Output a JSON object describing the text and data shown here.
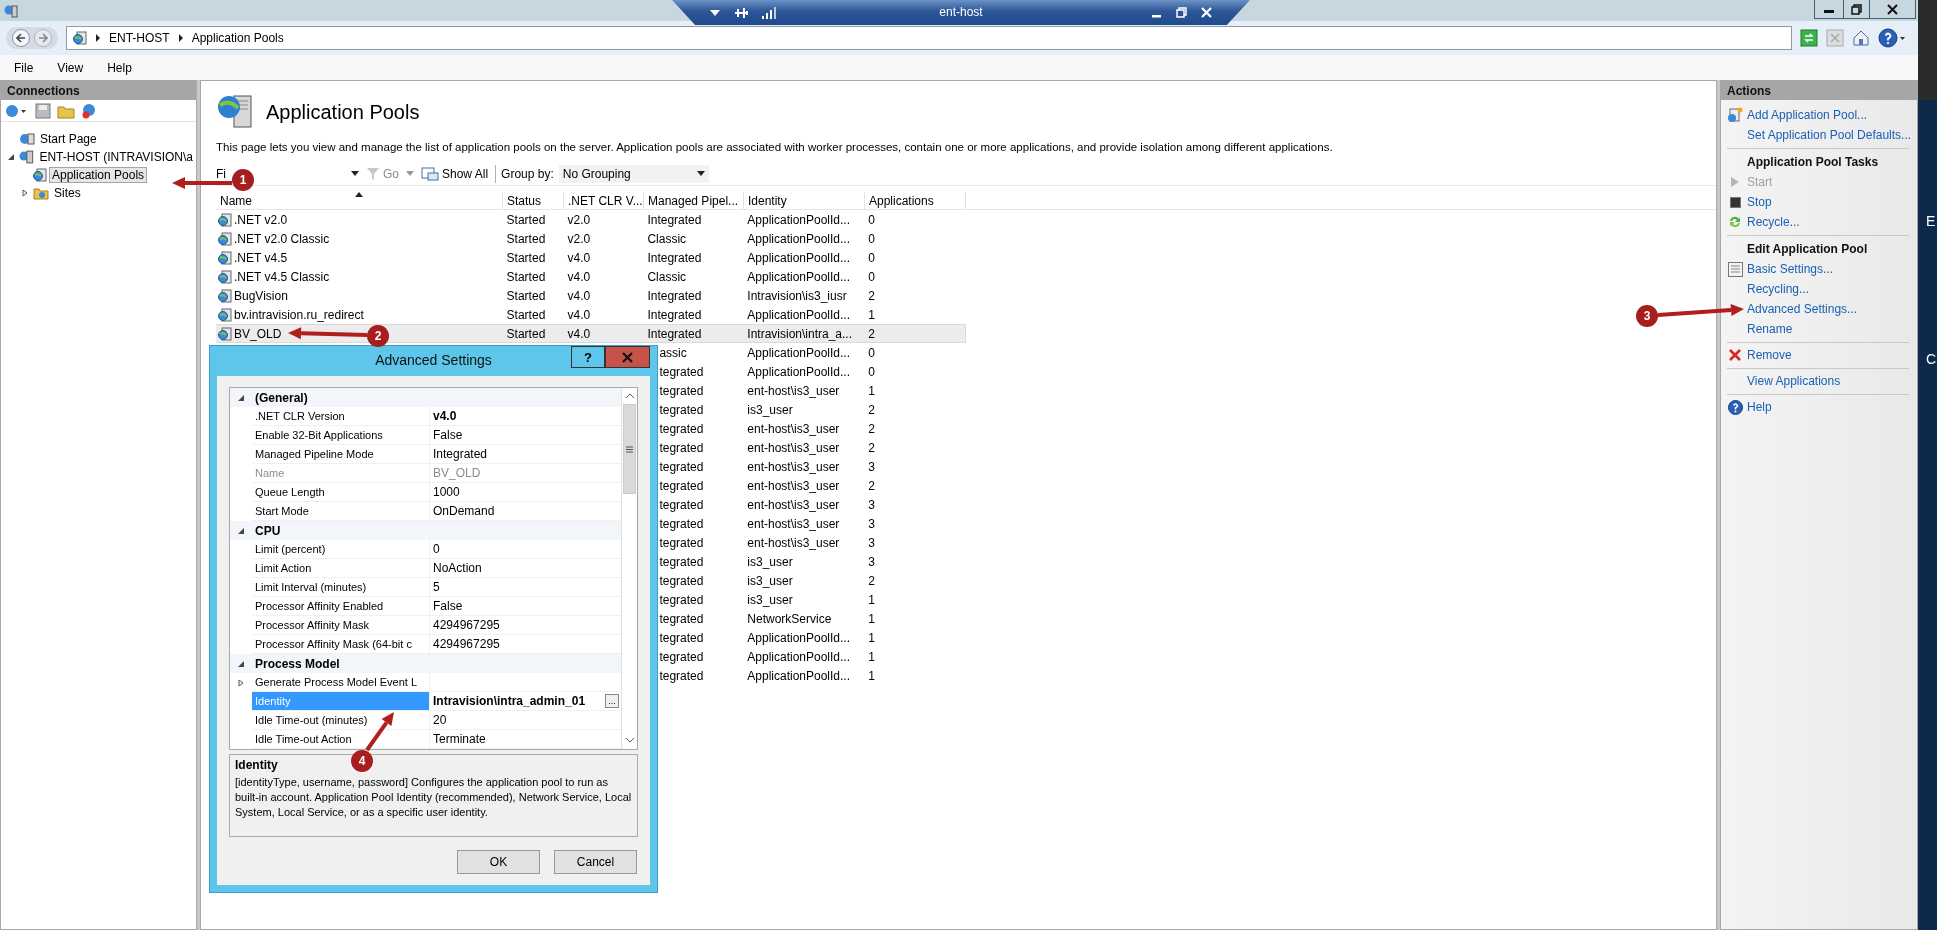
{
  "remote_bar": {
    "host": "ent-host"
  },
  "address_bar": {
    "breadcrumb": [
      "ENT-HOST",
      "Application Pools"
    ]
  },
  "menu": [
    "File",
    "View",
    "Help"
  ],
  "connections": {
    "title": "Connections",
    "tree": [
      {
        "label": "Start Page",
        "selected": false
      },
      {
        "label": "ENT-HOST (INTRAVISION\\a",
        "selected": false,
        "expanded": true,
        "children": [
          {
            "label": "Application Pools",
            "selected": true
          },
          {
            "label": "Sites",
            "selected": false,
            "expanded": false
          }
        ]
      }
    ]
  },
  "page": {
    "title": "Application Pools",
    "description": "This page lets you view and manage the list of application pools on the server. Application pools are associated with worker processes, contain one or more applications, and provide isolation among different applications."
  },
  "toolbar": {
    "filter_label": "Fi",
    "go": "Go",
    "go_disabled": true,
    "show_all": "Show All",
    "group_by_label": "Group by:",
    "group_by_value": "No Grouping"
  },
  "table": {
    "columns": [
      {
        "label": "Name",
        "sorted": true
      },
      {
        "label": "Status",
        "sorted": false
      },
      {
        "label": ".NET CLR V...",
        "sorted": false
      },
      {
        "label": "Managed Pipel...",
        "sorted": false
      },
      {
        "label": "Identity",
        "sorted": false
      },
      {
        "label": "Applications",
        "sorted": false
      }
    ],
    "rows": [
      {
        "kind": "full",
        "name": ".NET v2.0",
        "status": "Started",
        "clr": "v2.0",
        "pipeline": "Integrated",
        "identity": "ApplicationPoolId...",
        "applications": "0",
        "selected": false
      },
      {
        "kind": "full",
        "name": ".NET v2.0 Classic",
        "status": "Started",
        "clr": "v2.0",
        "pipeline": "Classic",
        "identity": "ApplicationPoolId...",
        "applications": "0",
        "selected": false
      },
      {
        "kind": "full",
        "name": ".NET v4.5",
        "status": "Started",
        "clr": "v4.0",
        "pipeline": "Integrated",
        "identity": "ApplicationPoolId...",
        "applications": "0",
        "selected": false
      },
      {
        "kind": "full",
        "name": ".NET v4.5 Classic",
        "status": "Started",
        "clr": "v4.0",
        "pipeline": "Classic",
        "identity": "ApplicationPoolId...",
        "applications": "0",
        "selected": false
      },
      {
        "kind": "full",
        "name": "BugVision",
        "status": "Started",
        "clr": "v4.0",
        "pipeline": "Integrated",
        "identity": "Intravision\\is3_iusr",
        "applications": "2",
        "selected": false
      },
      {
        "kind": "full",
        "name": "bv.intravision.ru_redirect",
        "status": "Started",
        "clr": "v4.0",
        "pipeline": "Integrated",
        "identity": "ApplicationPoolId...",
        "applications": "1",
        "selected": false
      },
      {
        "kind": "full",
        "name": "BV_OLD",
        "status": "Started",
        "clr": "v4.0",
        "pipeline": "Integrated",
        "identity": "Intravision\\intra_a...",
        "applications": "2",
        "selected": true
      },
      {
        "kind": "covered",
        "pipeline": "assic",
        "identity": "ApplicationPoolId...",
        "applications": "0",
        "selected": false
      },
      {
        "kind": "covered",
        "pipeline": "tegrated",
        "identity": "ApplicationPoolId...",
        "applications": "0",
        "selected": false
      },
      {
        "kind": "covered",
        "pipeline": "tegrated",
        "identity": "ent-host\\is3_user",
        "applications": "1",
        "selected": false
      },
      {
        "kind": "covered",
        "pipeline": "tegrated",
        "identity": "is3_user",
        "applications": "2",
        "selected": false
      },
      {
        "kind": "covered",
        "pipeline": "tegrated",
        "identity": "ent-host\\is3_user",
        "applications": "2",
        "selected": false
      },
      {
        "kind": "covered",
        "pipeline": "tegrated",
        "identity": "ent-host\\is3_user",
        "applications": "2",
        "selected": false
      },
      {
        "kind": "covered",
        "pipeline": "tegrated",
        "identity": "ent-host\\is3_user",
        "applications": "3",
        "selected": false
      },
      {
        "kind": "covered",
        "pipeline": "tegrated",
        "identity": "ent-host\\is3_user",
        "applications": "2",
        "selected": false
      },
      {
        "kind": "covered",
        "pipeline": "tegrated",
        "identity": "ent-host\\is3_user",
        "applications": "3",
        "selected": false
      },
      {
        "kind": "covered",
        "pipeline": "tegrated",
        "identity": "ent-host\\is3_user",
        "applications": "3",
        "selected": false
      },
      {
        "kind": "covered",
        "pipeline": "tegrated",
        "identity": "ent-host\\is3_user",
        "applications": "3",
        "selected": false
      },
      {
        "kind": "covered",
        "pipeline": "tegrated",
        "identity": "is3_user",
        "applications": "3",
        "selected": false
      },
      {
        "kind": "covered",
        "pipeline": "tegrated",
        "identity": "is3_user",
        "applications": "2",
        "selected": false
      },
      {
        "kind": "covered",
        "pipeline": "tegrated",
        "identity": "is3_user",
        "applications": "1",
        "selected": false
      },
      {
        "kind": "covered",
        "pipeline": "tegrated",
        "identity": "NetworkService",
        "applications": "1",
        "selected": false
      },
      {
        "kind": "covered",
        "pipeline": "tegrated",
        "identity": "ApplicationPoolId...",
        "applications": "1",
        "selected": false
      },
      {
        "kind": "covered",
        "pipeline": "tegrated",
        "identity": "ApplicationPoolId...",
        "applications": "1",
        "selected": false
      },
      {
        "kind": "covered",
        "pipeline": "tegrated",
        "identity": "ApplicationPoolId...",
        "applications": "1",
        "selected": false
      }
    ]
  },
  "dialog": {
    "title": "Advanced Settings",
    "help_button": "?",
    "grid": [
      {
        "kind": "category",
        "label": "(General)",
        "expanded": true
      },
      {
        "kind": "property",
        "name": ".NET CLR Version",
        "value": "v4.0",
        "modified": true,
        "disabled": false,
        "selected": false
      },
      {
        "kind": "property",
        "name": "Enable 32-Bit Applications",
        "value": "False",
        "modified": false,
        "disabled": false,
        "selected": false
      },
      {
        "kind": "property",
        "name": "Managed Pipeline Mode",
        "value": "Integrated",
        "modified": false,
        "disabled": false,
        "selected": false
      },
      {
        "kind": "property",
        "name": "Name",
        "value": "BV_OLD",
        "modified": false,
        "disabled": true,
        "selected": false
      },
      {
        "kind": "property",
        "name": "Queue Length",
        "value": "1000",
        "modified": false,
        "disabled": false,
        "selected": false
      },
      {
        "kind": "property",
        "name": "Start Mode",
        "value": "OnDemand",
        "modified": false,
        "disabled": false,
        "selected": false
      },
      {
        "kind": "category",
        "label": "CPU",
        "expanded": true
      },
      {
        "kind": "property",
        "name": "Limit (percent)",
        "value": "0",
        "modified": false,
        "disabled": false,
        "selected": false
      },
      {
        "kind": "property",
        "name": "Limit Action",
        "value": "NoAction",
        "modified": false,
        "disabled": false,
        "selected": false
      },
      {
        "kind": "property",
        "name": "Limit Interval (minutes)",
        "value": "5",
        "modified": false,
        "disabled": false,
        "selected": false
      },
      {
        "kind": "property",
        "name": "Processor Affinity Enabled",
        "value": "False",
        "modified": false,
        "disabled": false,
        "selected": false
      },
      {
        "kind": "property",
        "name": "Processor Affinity Mask",
        "value": "4294967295",
        "modified": false,
        "disabled": false,
        "selected": false
      },
      {
        "kind": "property",
        "name": "Processor Affinity Mask (64-bit c",
        "value": "4294967295",
        "modified": false,
        "disabled": false,
        "selected": false
      },
      {
        "kind": "category",
        "label": "Process Model",
        "expanded": true
      },
      {
        "kind": "property",
        "name": "Generate Process Model Event L",
        "expanded": false,
        "disabled": false,
        "selected": false
      },
      {
        "kind": "property",
        "name": "Identity",
        "value": "Intravision\\intra_admin_01",
        "editor_button": "...",
        "modified": true,
        "disabled": false,
        "selected": true
      },
      {
        "kind": "property",
        "name": "Idle Time-out (minutes)",
        "value": "20",
        "modified": false,
        "disabled": false,
        "selected": false
      },
      {
        "kind": "property",
        "name": "Idle Time-out Action",
        "value": "Terminate",
        "modified": false,
        "disabled": false,
        "selected": false
      }
    ],
    "description": {
      "title": "Identity",
      "text": "[identityType, username, password] Configures the application pool to run as built-in account. Application Pool Identity (recommended), Network Service, Local System, Local Service, or as a specific user identity."
    },
    "buttons": [
      "OK",
      "Cancel"
    ]
  },
  "actions": {
    "title": "Actions",
    "sections": [
      {
        "items": [
          {
            "label": "Add Application Pool...",
            "disabled": false
          },
          {
            "label": "Set Application Pool Defaults...",
            "disabled": false
          }
        ]
      },
      {
        "heading": "Application Pool Tasks",
        "items": [
          {
            "label": "Start",
            "disabled": true
          },
          {
            "label": "Stop",
            "disabled": false
          },
          {
            "label": "Recycle...",
            "disabled": false
          }
        ]
      },
      {
        "heading": "Edit Application Pool",
        "items": [
          {
            "label": "Basic Settings...",
            "disabled": false
          },
          {
            "label": "Recycling...",
            "disabled": false
          },
          {
            "label": "Advanced Settings...",
            "disabled": false
          },
          {
            "label": "Rename",
            "disabled": false
          }
        ]
      },
      {
        "items": [
          {
            "label": "Remove",
            "disabled": false
          }
        ]
      },
      {
        "items": [
          {
            "label": "View Applications",
            "disabled": false
          }
        ]
      },
      {
        "items": [
          {
            "label": "Help",
            "disabled": false
          }
        ]
      }
    ]
  },
  "annotations": [
    {
      "number": "1"
    },
    {
      "number": "2"
    },
    {
      "number": "3"
    },
    {
      "number": "4"
    }
  ],
  "desktop": {
    "labels": [
      "E",
      "C"
    ]
  }
}
